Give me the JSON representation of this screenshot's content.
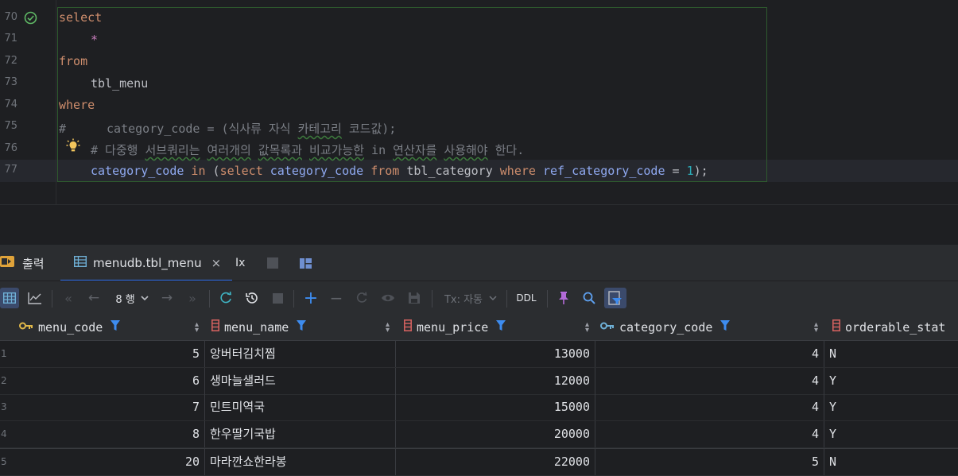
{
  "editor": {
    "line_numbers": [
      "70",
      "71",
      "72",
      "73",
      "74",
      "75",
      "76",
      "77"
    ],
    "lines": {
      "l70": "select",
      "l71": "*",
      "l72": "from",
      "l73": "tbl_menu",
      "l74": "where",
      "l75_hash": "#",
      "l75_text": "category_code = (식사류 자식 ",
      "l75_sq": "카테고리",
      "l75_tail": " 코드값);",
      "l76_a": "# 다중행 ",
      "l76_sq1": "서브쿼리는",
      "l76_b": " ",
      "l76_sq2": "여러개의",
      "l76_c": " ",
      "l76_sq3": "값목록과",
      "l76_d": " ",
      "l76_sq4": "비교가능한",
      "l76_e": " in ",
      "l76_sq5": "연산자를",
      "l76_f": " ",
      "l76_sq6": "사용해야",
      "l76_g": " 한다.",
      "l77_col1": "category_code",
      "l77_in": " in ",
      "l77_open": "(",
      "l77_select": "select",
      "l77_col2": " category_code ",
      "l77_from": "from",
      "l77_tbl": " tbl_category ",
      "l77_where": "where",
      "l77_col3": " ref_category_code ",
      "l77_eq": "= ",
      "l77_num": "1",
      "l77_close": ");"
    }
  },
  "tabs": {
    "output_label": "출력",
    "table_label": "menudb.tbl_menu",
    "close_glyph": "×",
    "x_label": "Ix"
  },
  "toolbar": {
    "rows_label": "8 행",
    "tx_label": "Tx: 자동",
    "ddl_label": "DDL"
  },
  "grid": {
    "columns": [
      "menu_code",
      "menu_name",
      "menu_price",
      "category_code",
      "orderable_stat"
    ],
    "rows": [
      {
        "n": "1",
        "menu_code": "5",
        "menu_name": "앙버터김치찜",
        "menu_price": "13000",
        "category_code": "4",
        "orderable": "N"
      },
      {
        "n": "2",
        "menu_code": "6",
        "menu_name": "생마늘샐러드",
        "menu_price": "12000",
        "category_code": "4",
        "orderable": "Y"
      },
      {
        "n": "3",
        "menu_code": "7",
        "menu_name": "민트미역국",
        "menu_price": "15000",
        "category_code": "4",
        "orderable": "Y"
      },
      {
        "n": "4",
        "menu_code": "8",
        "menu_name": "한우딸기국밥",
        "menu_price": "20000",
        "category_code": "4",
        "orderable": "Y"
      },
      {
        "n": "5",
        "menu_code": "20",
        "menu_name": "마라깐쇼한라봉",
        "menu_price": "22000",
        "category_code": "5",
        "orderable": "N"
      }
    ]
  },
  "colors": {
    "accent": "#3574f0",
    "keyword": "#cf8e6d",
    "column": "#8fa9f0",
    "number": "#2aacb8",
    "comment": "#7a7e85",
    "filter": "#3d8cf0"
  },
  "icons": [
    "check-circle-icon",
    "lightbulb-icon",
    "output-icon",
    "table-icon",
    "grid-view-icon",
    "chart-icon",
    "first-page-icon",
    "prev-page-icon",
    "next-page-icon",
    "last-page-icon",
    "refresh-icon",
    "history-icon",
    "stop-icon",
    "add-row-icon",
    "remove-row-icon",
    "revert-icon",
    "eye-icon",
    "save-icon",
    "pin-icon",
    "search-icon",
    "filter-icon",
    "key-icon",
    "column-icon"
  ]
}
